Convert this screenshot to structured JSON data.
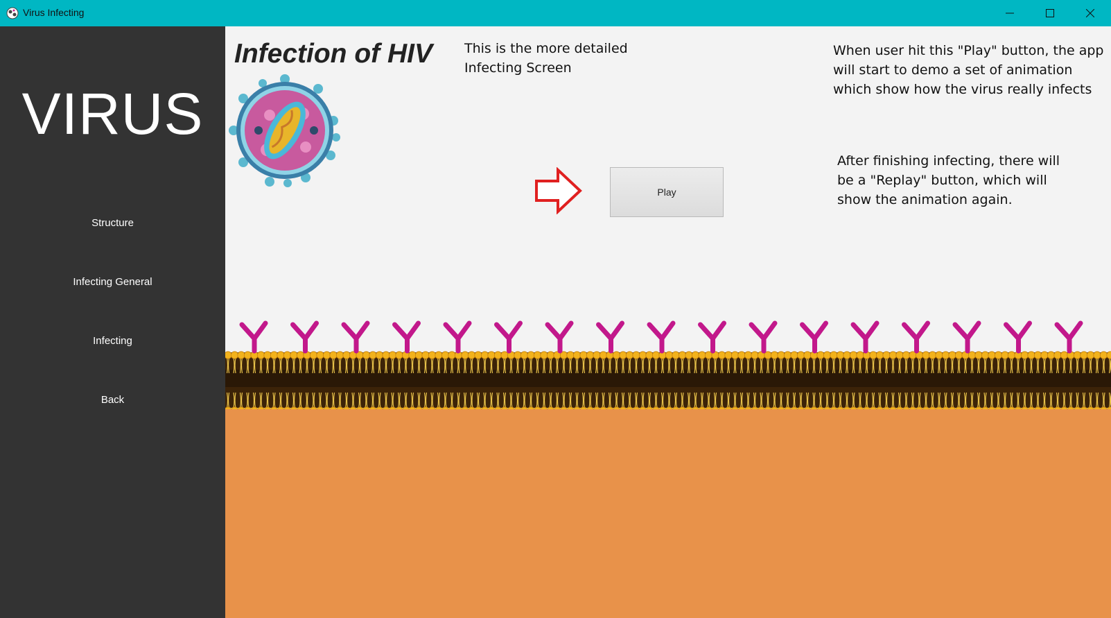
{
  "window": {
    "title": "Virus Infecting",
    "icon": "virus-app-icon",
    "controls": [
      "minimize-icon",
      "maximize-icon",
      "close-icon"
    ]
  },
  "sidebar": {
    "brand": "VIRUS",
    "items": [
      {
        "label": "Structure"
      },
      {
        "label": "Infecting General"
      },
      {
        "label": "Infecting"
      },
      {
        "label": "Back"
      }
    ]
  },
  "main": {
    "heading": "Infection of HIV",
    "note_screen": "This is the more detailed Infecting Screen",
    "note_play": "When user hit this \"Play\" button, the app will start to demo a set of animation which show how the virus really infects",
    "note_replay": "After finishing infecting, there will be a \"Replay\" button, which will show the animation again.",
    "play_button": "Play",
    "arrow_icon": "red-arrow-right-icon"
  },
  "colors": {
    "titlebar": "#00b7c3",
    "sidebar": "#333333",
    "main_bg": "#f3f3f3",
    "cytoplasm": "#e8924a",
    "receptor": "#c2188b",
    "arrow": "#e02020"
  }
}
